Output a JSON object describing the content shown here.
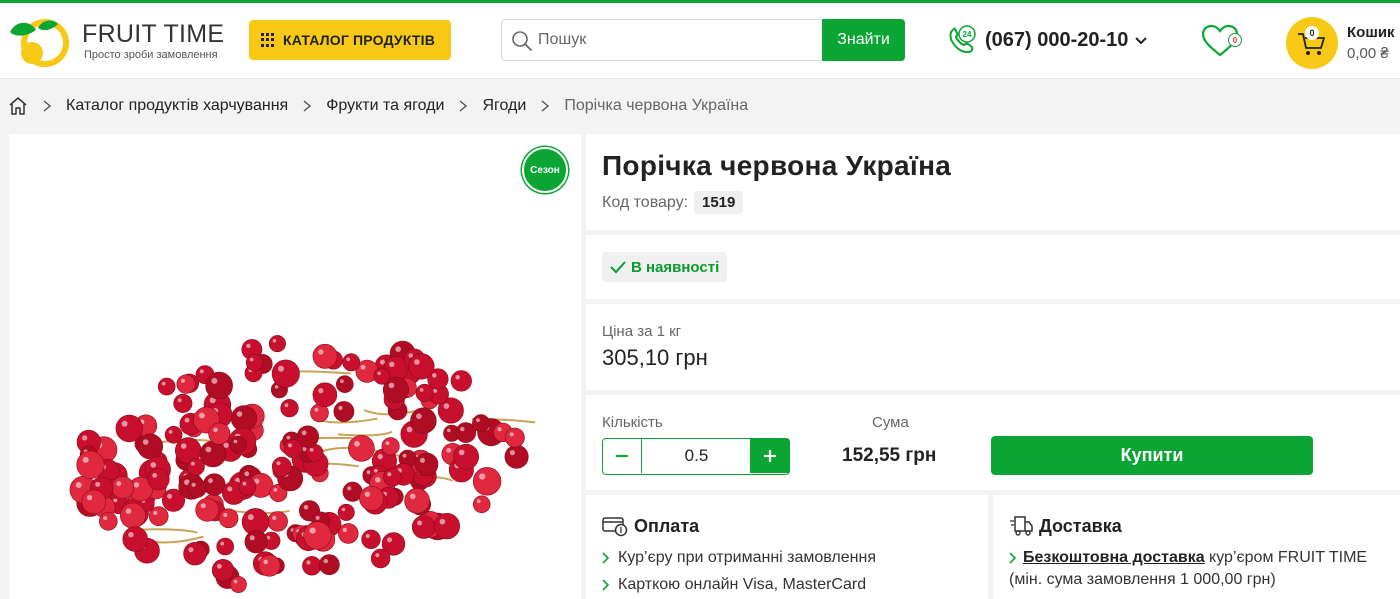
{
  "brand": {
    "name": "FRUIT TIME",
    "tagline": "Просто зроби замовлення",
    "accent_color": "#0aa532",
    "yellow_color": "#f7c815"
  },
  "header": {
    "catalog_label": "КАТАЛОГ ПРОДУКТІВ",
    "search_placeholder": "Пошук",
    "search_button": "Знайти",
    "phone": "(067) 000-20-10",
    "phone_icon_label": "24",
    "favorites_count": "0",
    "cart_count": "0",
    "cart_label": "Кошик",
    "cart_total": "0,00 ₴"
  },
  "breadcrumb": {
    "items": [
      "Каталог продуктів харчування",
      "Фрукти та ягоди",
      "Ягоди"
    ],
    "current": "Порічка червона Україна"
  },
  "product": {
    "badge": "Сезон",
    "title": "Порічка червона Україна",
    "sku_label": "Код товару:",
    "sku": "1519",
    "stock": "В наявності",
    "price_label": "Ціна за 1 кг",
    "price": "305,10 грн",
    "qty_label": "Кількість",
    "qty": "0.5",
    "sum_label": "Сума",
    "sum": "152,55 грн",
    "buy_label": "Купити"
  },
  "payment": {
    "title": "Оплата",
    "items": [
      "Кур’єру при отриманні замовлення",
      "Карткою онлайн Visa, MasterCard"
    ]
  },
  "delivery": {
    "title": "Доставка",
    "link": "Безкоштовна доставка",
    "text": " кур’єром FRUIT TIME (мін. сума замовлення 1 000,00 грн)"
  }
}
